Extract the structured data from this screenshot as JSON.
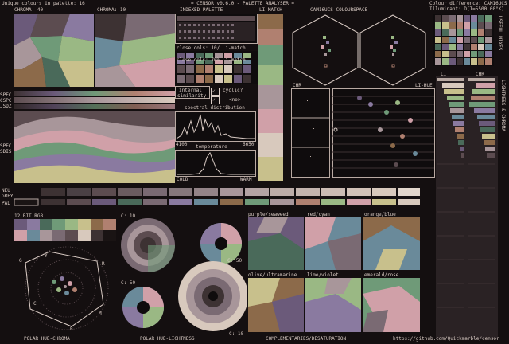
{
  "header": {
    "unique": "Unique colours in palette: 16",
    "title": "= CENSOR v0.6.0 - PALETTE ANALYSER =",
    "diff": "Colour difference: CAM16UCS",
    "illum": "Illuminant: D(T=5500.00°K)",
    "chroma40": "CHROMA: 40",
    "chroma10": "CHROMA: 10",
    "indexed": "INDEXED PALETTE",
    "limatch": "LI-MATCH",
    "cam": "CAM16UCS COLOURSPACE"
  },
  "side_labels": {
    "spec": "SPEC",
    "cspc": "CSPC",
    "jsdz": "JSDZ",
    "spec2": "SPEC",
    "sdis": "SDIS",
    "neu": "NEU",
    "grey": "GREY",
    "pal": "PAL"
  },
  "palette": {
    "close1": "close cols: 10/ Li-match",
    "close2": "close cols: 70% Li-match",
    "internal1": "internal",
    "internal2": "similarity",
    "cyclic": "cyclic?",
    "no": "<no>",
    "spectral": "spectral distribution",
    "w1": "4100",
    "w2": "6650",
    "temperature": "temperature",
    "cold": "COLD",
    "warm": "WARM"
  },
  "middle": {
    "chr": "CHR",
    "lihue": "LI-HUE"
  },
  "right": {
    "useful": "USEFUL MIXES",
    "lightness": "LIGHTNESS & CHROMA",
    "li": "LI",
    "chr": "CHR"
  },
  "bottom": {
    "rgb": "12 BIT RGB",
    "c10a": "C: 10",
    "c50a": "C: 50",
    "c50b": "C: 50",
    "c10b": "C: 10",
    "polar_hc": "POLAR HUE-CHROMA",
    "polar_hl": "POLAR HUE-LIGHTNESS",
    "comp": "COMPLEMENTARIES/DESATURATION",
    "url": "https://github.com/Quickmarble/censor",
    "g": "G",
    "y": "Y",
    "r": "R",
    "c": "C",
    "m": "M",
    "b": "B",
    "pairs": [
      "purple/seaweed",
      "red/cyan",
      "orange/blue",
      "olive/ultramarine",
      "lime/violet",
      "emerald/rose"
    ]
  },
  "colors": {
    "bg": "#140f10",
    "frame": "#b9aaa3",
    "text": "#d9cbc4",
    "palette": [
      "#1a1414",
      "#3d3233",
      "#5c4c50",
      "#7a6a73",
      "#a8969a",
      "#d8c9bd",
      "#6b5a7a",
      "#8a7aa0",
      "#4a6a5a",
      "#6f9a78",
      "#9ab884",
      "#c8c08c",
      "#8c6a4a",
      "#b08070",
      "#d0a0a8",
      "#6a8a9a"
    ]
  }
}
